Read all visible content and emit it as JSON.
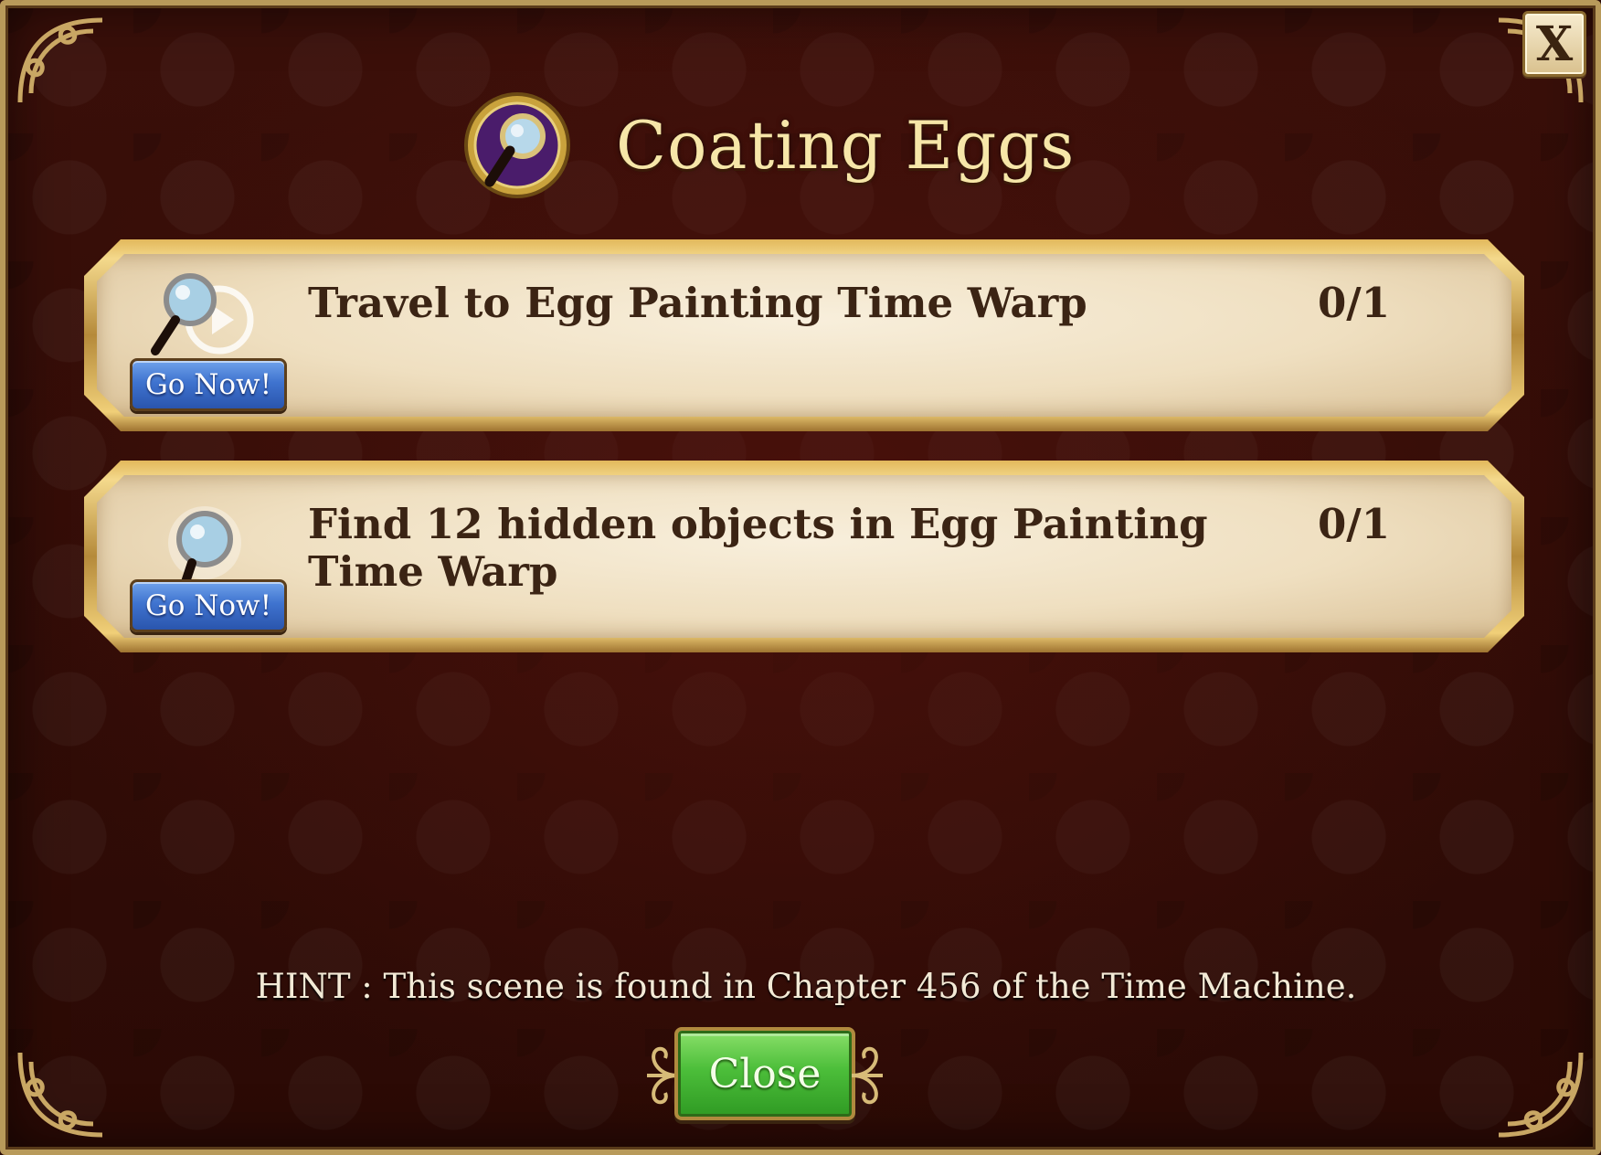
{
  "dialog": {
    "title": "Coating Eggs",
    "close_x_label": "X",
    "header_icon": "magnifying-glass-icon"
  },
  "tasks": [
    {
      "icon": "magnifier-play-icon",
      "description": "Travel to Egg Painting Time Warp",
      "progress": "0/1",
      "button_label": "Go Now!"
    },
    {
      "icon": "magnifier-sparkle-icon",
      "description": "Find 12 hidden objects in Egg Painting Time Warp",
      "progress": "0/1",
      "button_label": "Go Now!"
    }
  ],
  "hint": "HINT : This scene is found in Chapter 456 of the Time Machine.",
  "close_button_label": "Close",
  "colors": {
    "background": "#2b0a05",
    "title": "#f6e6a8",
    "panel": "#efdfc0",
    "go_button": "#3f73cf",
    "close_button": "#4cbe3a"
  }
}
